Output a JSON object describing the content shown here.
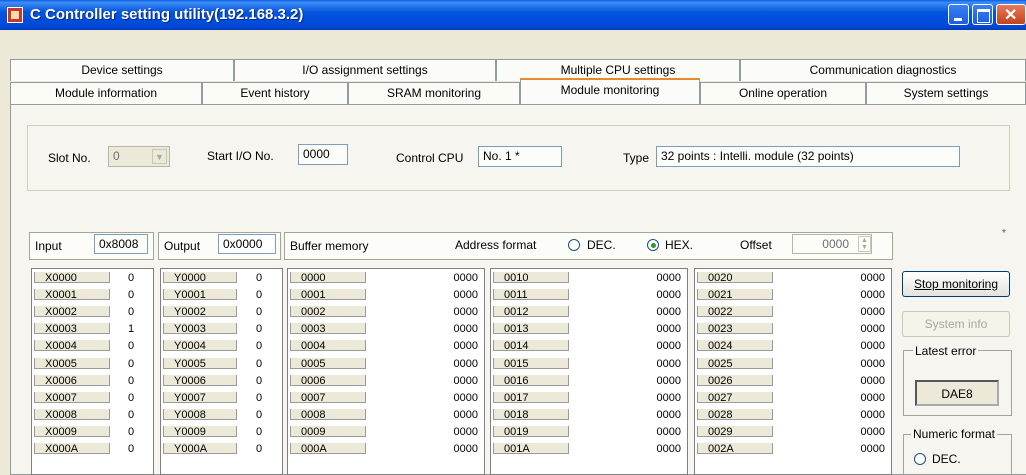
{
  "window": {
    "title": "C Controller setting utility(192.168.3.2)"
  },
  "tabs_row1": [
    "Device settings",
    "I/O assignment settings",
    "Multiple CPU settings",
    "Communication diagnostics"
  ],
  "tabs_row2": [
    "Module information",
    "Event history",
    "SRAM monitoring",
    "Module monitoring",
    "Online operation",
    "System settings"
  ],
  "active_tab": "Module monitoring",
  "module": {
    "slot_label": "Slot No.",
    "slot_value": "0",
    "start_io_label": "Start I/O No.",
    "start_io_value": "0000",
    "control_cpu_label": "Control CPU",
    "control_cpu_value": "No. 1 *",
    "type_label": "Type",
    "type_value": "32 points : Intelli. module (32 points)"
  },
  "monitor": {
    "input_label": "Input",
    "input_value": "0x8008",
    "output_label": "Output",
    "output_value": "0x0000",
    "buffer_label": "Buffer memory",
    "address_format_label": "Address format",
    "dec_label": "DEC.",
    "hex_label": "HEX.",
    "address_format_selected": "HEX.",
    "offset_label": "Offset",
    "offset_value": "0000",
    "asterisk": "*"
  },
  "input_rows": [
    [
      "X0000",
      "0"
    ],
    [
      "X0001",
      "0"
    ],
    [
      "X0002",
      "0"
    ],
    [
      "X0003",
      "1"
    ],
    [
      "X0004",
      "0"
    ],
    [
      "X0005",
      "0"
    ],
    [
      "X0006",
      "0"
    ],
    [
      "X0007",
      "0"
    ],
    [
      "X0008",
      "0"
    ],
    [
      "X0009",
      "0"
    ],
    [
      "X000A",
      "0"
    ]
  ],
  "output_rows": [
    [
      "Y0000",
      "0"
    ],
    [
      "Y0001",
      "0"
    ],
    [
      "Y0002",
      "0"
    ],
    [
      "Y0003",
      "0"
    ],
    [
      "Y0004",
      "0"
    ],
    [
      "Y0005",
      "0"
    ],
    [
      "Y0006",
      "0"
    ],
    [
      "Y0007",
      "0"
    ],
    [
      "Y0008",
      "0"
    ],
    [
      "Y0009",
      "0"
    ],
    [
      "Y000A",
      "0"
    ]
  ],
  "buffer_cols": [
    [
      [
        "0000",
        "0000"
      ],
      [
        "0001",
        "0000"
      ],
      [
        "0002",
        "0000"
      ],
      [
        "0003",
        "0000"
      ],
      [
        "0004",
        "0000"
      ],
      [
        "0005",
        "0000"
      ],
      [
        "0006",
        "0000"
      ],
      [
        "0007",
        "0000"
      ],
      [
        "0008",
        "0000"
      ],
      [
        "0009",
        "0000"
      ],
      [
        "000A",
        "0000"
      ]
    ],
    [
      [
        "0010",
        "0000"
      ],
      [
        "0011",
        "0000"
      ],
      [
        "0012",
        "0000"
      ],
      [
        "0013",
        "0000"
      ],
      [
        "0014",
        "0000"
      ],
      [
        "0015",
        "0000"
      ],
      [
        "0016",
        "0000"
      ],
      [
        "0017",
        "0000"
      ],
      [
        "0018",
        "0000"
      ],
      [
        "0019",
        "0000"
      ],
      [
        "001A",
        "0000"
      ]
    ],
    [
      [
        "0020",
        "0000"
      ],
      [
        "0021",
        "0000"
      ],
      [
        "0022",
        "0000"
      ],
      [
        "0023",
        "0000"
      ],
      [
        "0024",
        "0000"
      ],
      [
        "0025",
        "0000"
      ],
      [
        "0026",
        "0000"
      ],
      [
        "0027",
        "0000"
      ],
      [
        "0028",
        "0000"
      ],
      [
        "0029",
        "0000"
      ],
      [
        "002A",
        "0000"
      ]
    ]
  ],
  "side": {
    "stop_label": "Stop monitoring",
    "sysinfo_label": "System info",
    "latest_error_label": "Latest error",
    "latest_error_value": "DAE8",
    "numeric_format_label": "Numeric format",
    "numeric_dec_label": "DEC."
  }
}
